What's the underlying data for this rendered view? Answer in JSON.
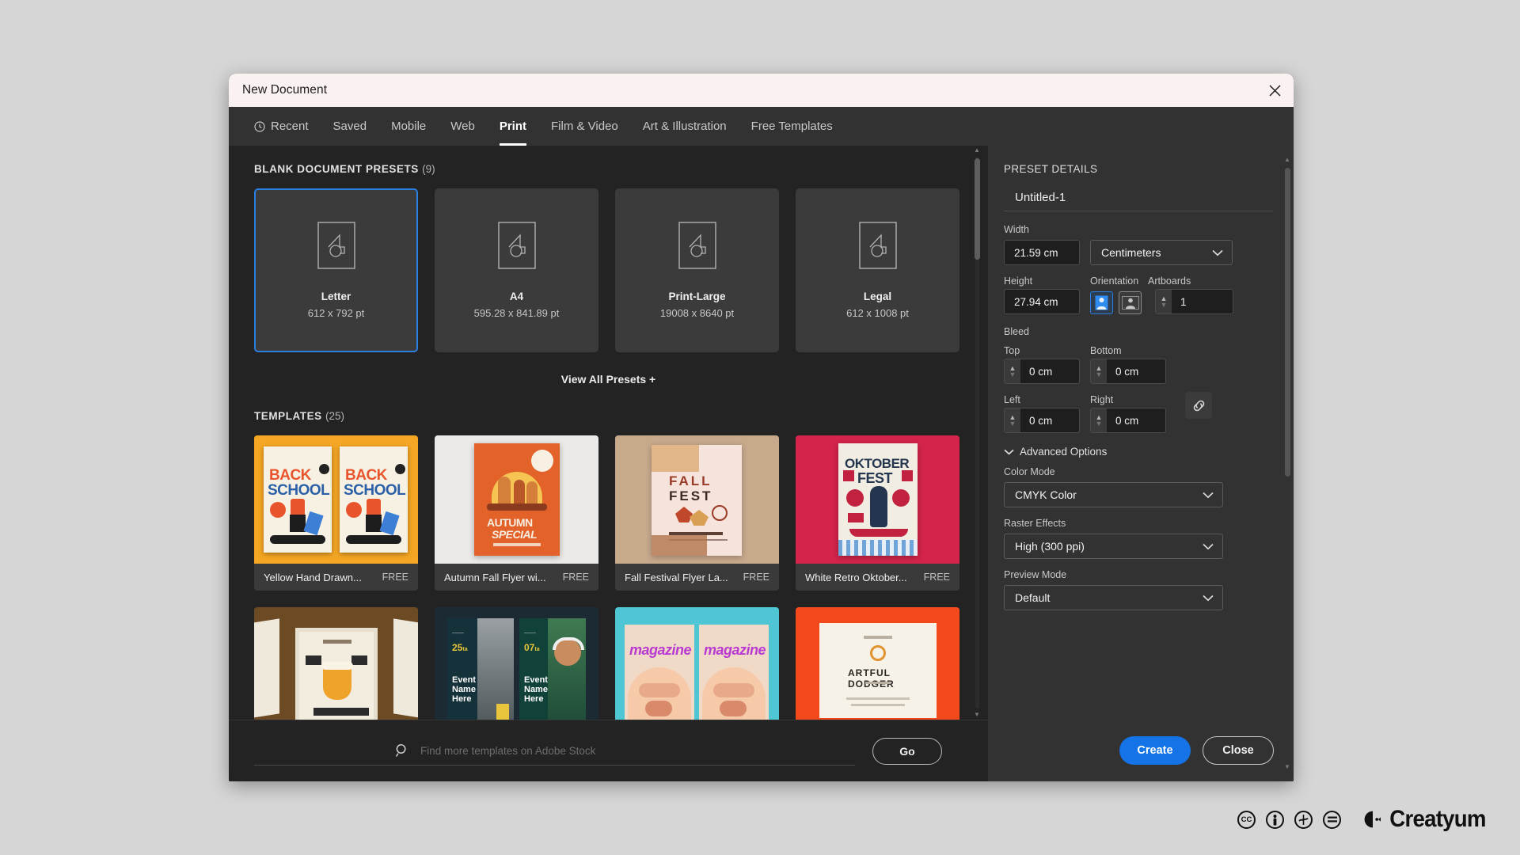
{
  "window": {
    "title": "New Document",
    "close_icon": "close-icon"
  },
  "tabs": [
    {
      "label": "Recent",
      "icon": "clock-icon",
      "active": false
    },
    {
      "label": "Saved",
      "active": false
    },
    {
      "label": "Mobile",
      "active": false
    },
    {
      "label": "Web",
      "active": false
    },
    {
      "label": "Print",
      "active": true
    },
    {
      "label": "Film & Video",
      "active": false
    },
    {
      "label": "Art & Illustration",
      "active": false
    },
    {
      "label": "Free Templates",
      "active": false
    }
  ],
  "presets_section": {
    "heading": "BLANK DOCUMENT PRESETS",
    "count": "(9)",
    "view_all_label": "View All Presets +",
    "items": [
      {
        "name": "Letter",
        "dims": "612 x 792 pt",
        "selected": true
      },
      {
        "name": "A4",
        "dims": "595.28 x 841.89 pt",
        "selected": false
      },
      {
        "name": "Print-Large",
        "dims": "19008 x 8640 pt",
        "selected": false
      },
      {
        "name": "Legal",
        "dims": "612 x 1008 pt",
        "selected": false
      }
    ]
  },
  "templates_section": {
    "heading": "TEMPLATES",
    "count": "(25)",
    "row1": [
      {
        "title": "Yellow Hand Drawn...",
        "price": "FREE",
        "art": "back-school",
        "bg": "#f5a623"
      },
      {
        "title": "Autumn Fall Flyer wi...",
        "price": "FREE",
        "art": "autumn-special",
        "bg": "#e9e9e7"
      },
      {
        "title": "Fall Festival Flyer La...",
        "price": "FREE",
        "art": "fall-fest",
        "bg": "#c7a98c"
      },
      {
        "title": "White Retro Oktober...",
        "price": "FREE",
        "art": "oktober-fest",
        "bg": "#d4244b"
      }
    ],
    "row2": [
      {
        "art": "oktoberfest-mockup",
        "bg": "#6b4a24"
      },
      {
        "art": "event-name-here",
        "bg": "#1c2b33"
      },
      {
        "art": "magazine",
        "bg": "#4fc6d4"
      },
      {
        "art": "artful-dodger",
        "bg": "#f4481d"
      }
    ]
  },
  "search": {
    "icon": "search-icon",
    "placeholder": "Find more templates on Adobe Stock",
    "value": "",
    "go_label": "Go"
  },
  "preset_details": {
    "heading": "PRESET DETAILS",
    "document_name": "Untitled-1",
    "width": {
      "label": "Width",
      "value": "21.59 cm"
    },
    "units": {
      "value": "Centimeters"
    },
    "height": {
      "label": "Height",
      "value": "27.94 cm"
    },
    "orientation": {
      "label": "Orientation",
      "portrait_icon": "portrait-orientation-icon",
      "landscape_icon": "landscape-orientation-icon",
      "selected": "portrait"
    },
    "artboards": {
      "label": "Artboards",
      "value": "1"
    },
    "bleed": {
      "label": "Bleed",
      "top": {
        "label": "Top",
        "value": "0 cm"
      },
      "bottom": {
        "label": "Bottom",
        "value": "0 cm"
      },
      "left": {
        "label": "Left",
        "value": "0 cm"
      },
      "right": {
        "label": "Right",
        "value": "0 cm"
      },
      "link_icon": "link-chain-icon"
    },
    "advanced": {
      "toggle_label": "Advanced Options",
      "color_mode": {
        "label": "Color Mode",
        "value": "CMYK Color"
      },
      "raster_effects": {
        "label": "Raster Effects",
        "value": "High (300 ppi)"
      },
      "preview_mode": {
        "label": "Preview Mode",
        "value": "Default"
      }
    },
    "create_label": "Create",
    "close_label": "Close"
  },
  "watermark": {
    "icons": [
      "cc-icon",
      "by-icon",
      "nc-icon",
      "nd-icon"
    ],
    "cc_text": "CC",
    "brand": "Creatyum"
  },
  "colors": {
    "accent": "#1473e6",
    "selection": "#2a7fe0",
    "dialog_bg": "#2b2b2b",
    "panel_bg": "#323232",
    "content_bg": "#232323",
    "titlebar_bg": "#faf1f1",
    "page_bg": "#d6d6d6"
  }
}
